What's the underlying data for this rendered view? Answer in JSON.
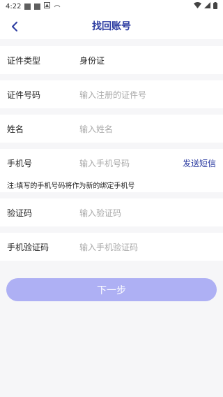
{
  "status": {
    "time": "4:22"
  },
  "header": {
    "title": "找回账号",
    "back_icon": "chevron-left-icon"
  },
  "form": {
    "id_type": {
      "label": "证件类型",
      "value": "身份证"
    },
    "id_number": {
      "label": "证件号码",
      "placeholder": "输入注册的证件号"
    },
    "name": {
      "label": "姓名",
      "placeholder": "输入姓名"
    },
    "phone": {
      "label": "手机号",
      "placeholder": "输入手机号码",
      "send_sms_label": "发送短信"
    },
    "note": "注:填写的手机号码将作为新的绑定手机号",
    "captcha": {
      "label": "验证码",
      "placeholder": "输入验证码"
    },
    "sms_code": {
      "label": "手机验证码",
      "placeholder": "输入手机验证码"
    }
  },
  "next_button": {
    "label": "下一步"
  },
  "colors": {
    "accent": "#2a3aa0",
    "button_disabled": "#aeb0f4",
    "placeholder": "#a8a8a8",
    "background": "#f6f6f8"
  }
}
